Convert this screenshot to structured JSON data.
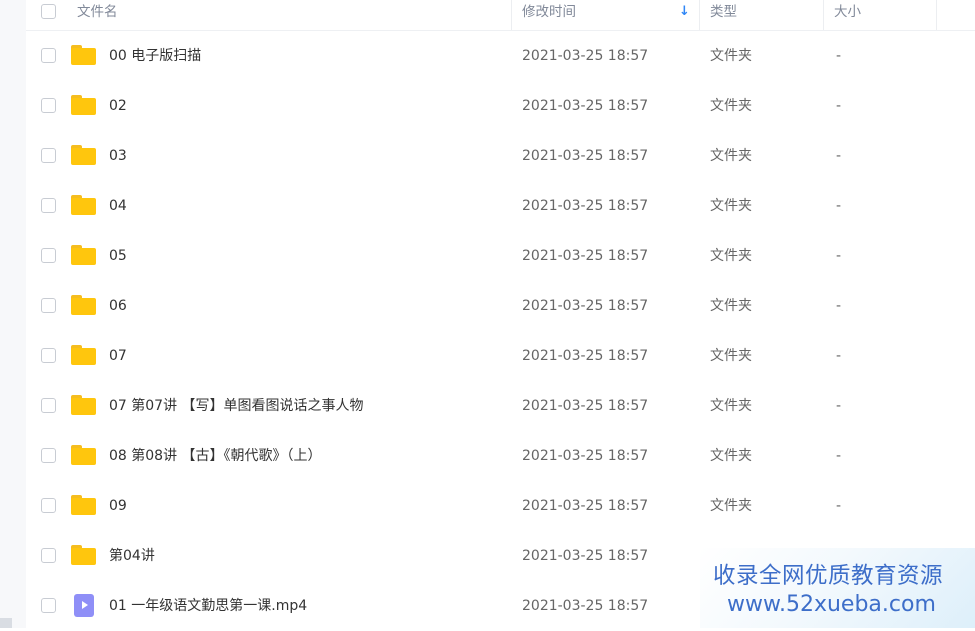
{
  "header": {
    "name_label": "文件名",
    "time_label": "修改时间",
    "type_label": "类型",
    "size_label": "大小",
    "sort_arrow": "↓"
  },
  "rows": [
    {
      "icon": "folder-icon",
      "name": "00 电子版扫描",
      "time": "2021-03-25 18:57",
      "type": "文件夹",
      "size": "-"
    },
    {
      "icon": "folder-icon",
      "name": "02",
      "time": "2021-03-25 18:57",
      "type": "文件夹",
      "size": "-"
    },
    {
      "icon": "folder-icon",
      "name": "03",
      "time": "2021-03-25 18:57",
      "type": "文件夹",
      "size": "-"
    },
    {
      "icon": "folder-icon",
      "name": "04",
      "time": "2021-03-25 18:57",
      "type": "文件夹",
      "size": "-"
    },
    {
      "icon": "folder-icon",
      "name": "05",
      "time": "2021-03-25 18:57",
      "type": "文件夹",
      "size": "-"
    },
    {
      "icon": "folder-icon",
      "name": "06",
      "time": "2021-03-25 18:57",
      "type": "文件夹",
      "size": "-"
    },
    {
      "icon": "folder-icon",
      "name": "07",
      "time": "2021-03-25 18:57",
      "type": "文件夹",
      "size": "-"
    },
    {
      "icon": "folder-icon",
      "name": "07 第07讲 【写】单图看图说话之事人物",
      "time": "2021-03-25 18:57",
      "type": "文件夹",
      "size": "-"
    },
    {
      "icon": "folder-icon",
      "name": "08 第08讲 【古】《朝代歌》（上）",
      "time": "2021-03-25 18:57",
      "type": "文件夹",
      "size": "-"
    },
    {
      "icon": "folder-icon",
      "name": "09",
      "time": "2021-03-25 18:57",
      "type": "文件夹",
      "size": "-"
    },
    {
      "icon": "folder-icon",
      "name": "第04讲",
      "time": "2021-03-25 18:57",
      "type": "",
      "size": ""
    },
    {
      "icon": "video-file-icon",
      "name": "01 一年级语文勤思第一课.mp4",
      "time": "2021-03-25 18:57",
      "type": "",
      "size": ""
    }
  ],
  "watermark": {
    "line1": "收录全网优质教育资源",
    "line2": "www.52xueba.com"
  },
  "colors": {
    "folder": "#ffc60d",
    "video_icon": "#8f8ff7",
    "sort_arrow": "#2f86f6",
    "watermark_text": "#3d6ec9"
  }
}
